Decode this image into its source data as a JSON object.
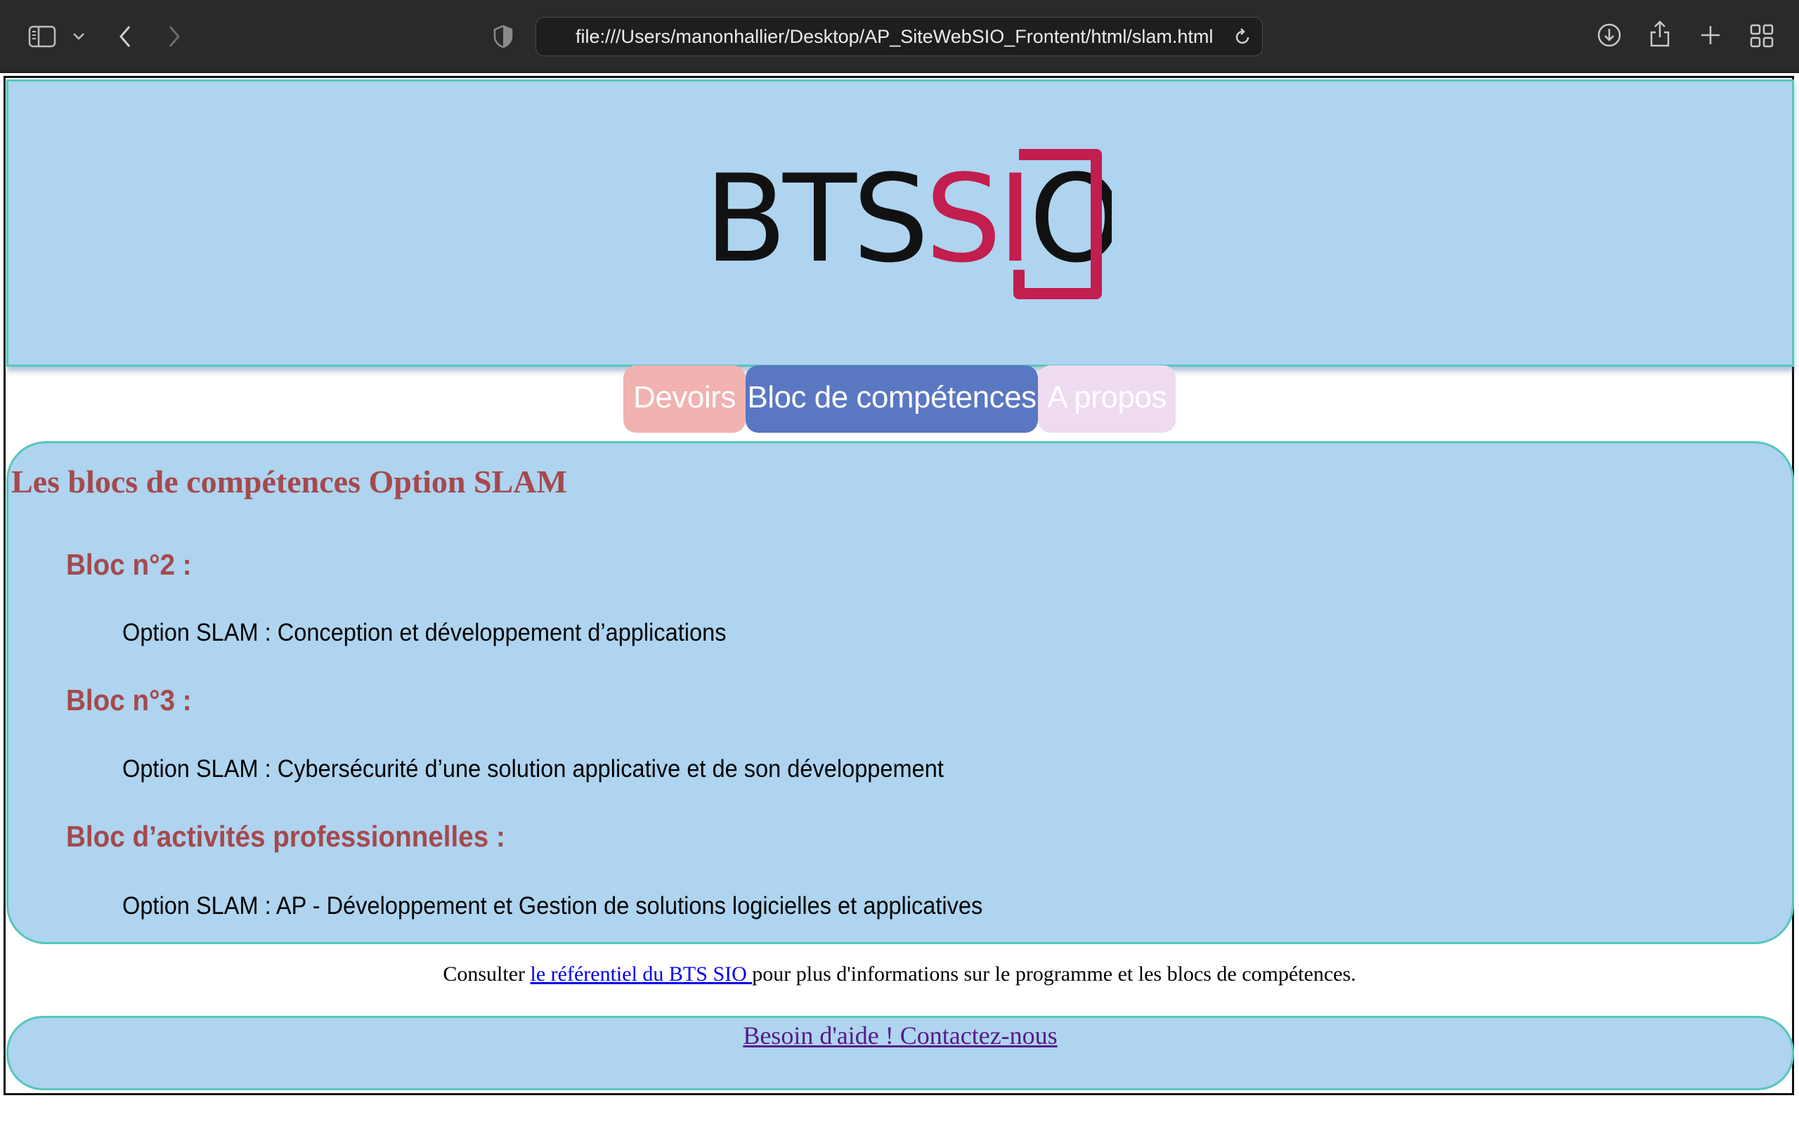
{
  "browser": {
    "url": "file:///Users/manonhallier/Desktop/AP_SiteWebSIO_Frontent/html/slam.html"
  },
  "header": {
    "logo": {
      "text_black": "BTS",
      "text_red": "SIO",
      "brand_red": "#c21e4e"
    }
  },
  "nav": {
    "items": [
      {
        "label": "Devoirs"
      },
      {
        "label": "Bloc de compétences",
        "active": true
      },
      {
        "label": "A propos"
      }
    ]
  },
  "main": {
    "title": "Les blocs de compétences Option SLAM",
    "blocks": [
      {
        "heading": "Bloc n°2 :",
        "text": "Option SLAM : Conception et développement d’applications"
      },
      {
        "heading": "Bloc n°3 :",
        "text": "Option SLAM : Cybersécurité d’une solution applicative et de son développement"
      },
      {
        "heading": "Bloc d’activités professionnelles :",
        "text": "Option SLAM : AP - Développement et Gestion de solutions logicielles et applicatives"
      }
    ]
  },
  "consult": {
    "prefix": "Consulter ",
    "link": "le référentiel du BTS SIO ",
    "suffix": "pour plus d'informations sur le programme et les blocs de compétences."
  },
  "footer": {
    "link": "Besoin d'aide ! Contactez-nous"
  }
}
